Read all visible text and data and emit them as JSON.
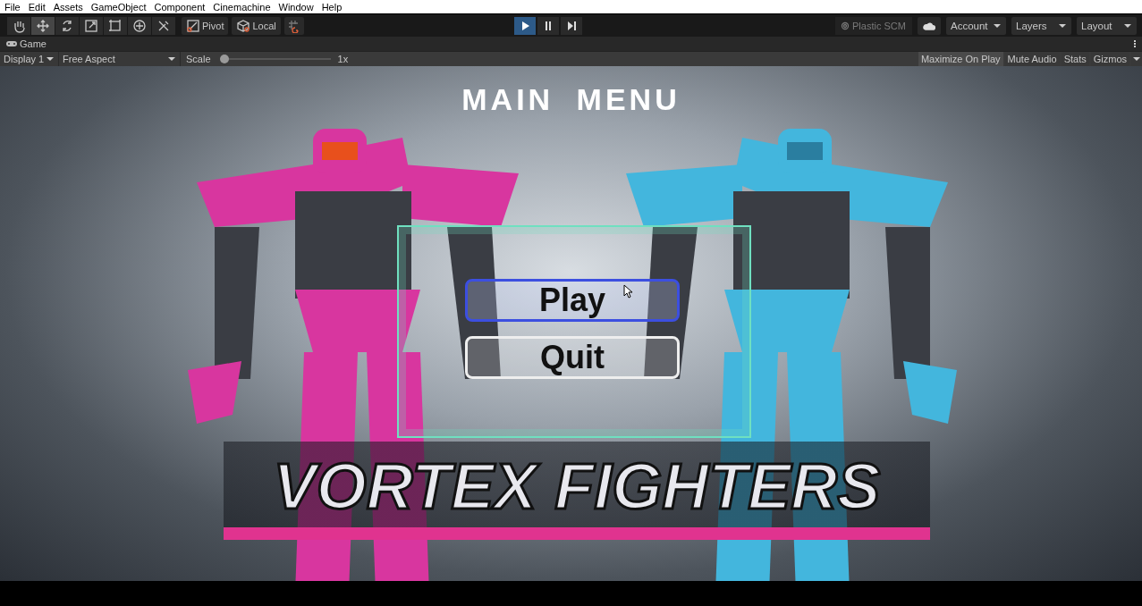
{
  "menu_bar": {
    "items": [
      "File",
      "Edit",
      "Assets",
      "GameObject",
      "Component",
      "Cinemachine",
      "Window",
      "Help"
    ]
  },
  "toolbar": {
    "tools": [
      {
        "kind": "hand",
        "selected": false
      },
      {
        "kind": "move",
        "selected": true
      },
      {
        "kind": "rotate",
        "selected": false
      },
      {
        "kind": "scale",
        "selected": false
      },
      {
        "kind": "rect",
        "selected": false
      },
      {
        "kind": "transform",
        "selected": false
      },
      {
        "kind": "custom",
        "selected": false
      }
    ],
    "handle_buttons": [
      {
        "kind": "pivot",
        "label": "Pivot"
      },
      {
        "kind": "local",
        "label": "Local"
      }
    ],
    "play_controls": [
      {
        "kind": "play",
        "selected": true
      },
      {
        "kind": "pause",
        "selected": false
      },
      {
        "kind": "step",
        "selected": false
      }
    ],
    "plastic_scm": {
      "label": "Plastic SCM",
      "disabled": true
    },
    "dropdowns": [
      "Account",
      "Layers",
      "Layout"
    ]
  },
  "game_tab": {
    "label": "Game"
  },
  "game_toolbar": {
    "display": "Display 1",
    "aspect": "Free Aspect",
    "scale_label": "Scale",
    "scale": {
      "level": 0.0,
      "reading": "1x"
    },
    "toggles": [
      {
        "label": "Maximize On Play",
        "selected": true
      },
      {
        "label": "Mute Audio",
        "selected": false
      },
      {
        "label": "Stats",
        "selected": false
      },
      {
        "label": "Gizmos",
        "selected": false
      }
    ]
  },
  "scene": {
    "title": "MAIN MENU",
    "buttons": [
      {
        "label": "Play",
        "selected": true
      },
      {
        "label": "Quit",
        "selected": false
      }
    ],
    "logo": "VORTEX FIGHTERS"
  }
}
